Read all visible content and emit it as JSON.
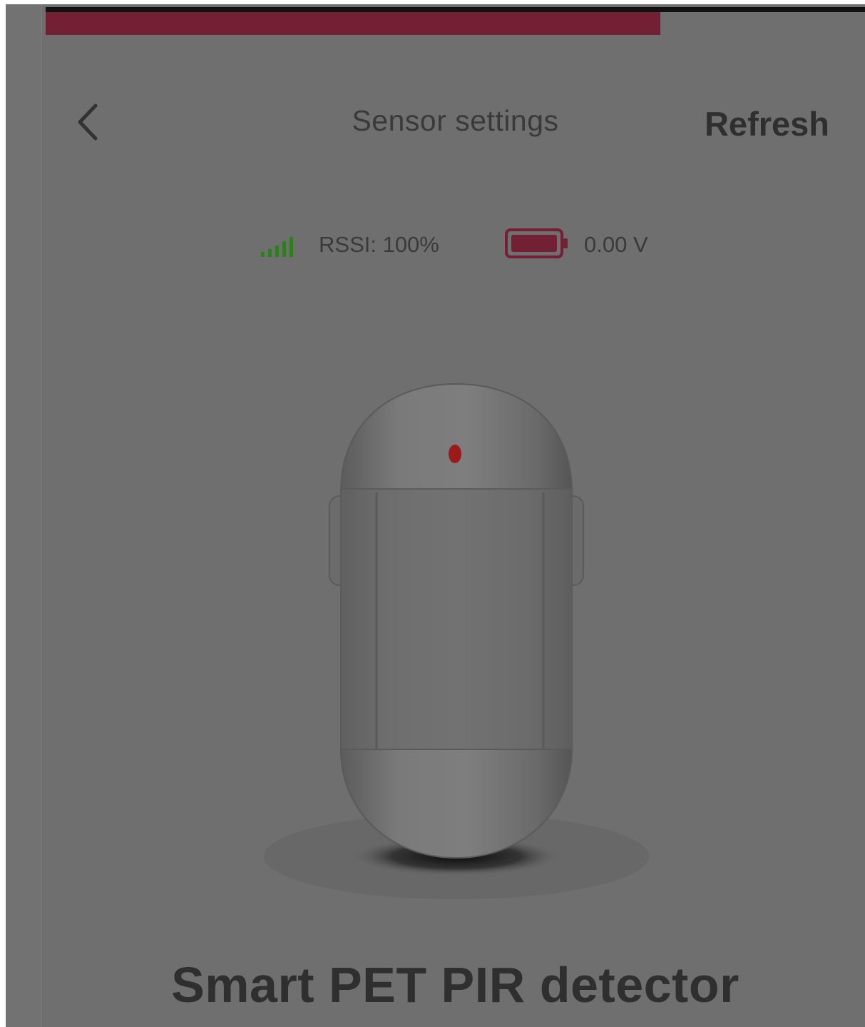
{
  "header": {
    "title": "Sensor settings",
    "refresh_label": "Refresh",
    "back_icon": "chevron-left-icon"
  },
  "progress": {
    "fraction": 0.75,
    "color": "#731f34"
  },
  "status": {
    "signal_icon": "signal-bars-icon",
    "rssi_text": "RSSI: 100%",
    "battery_icon": "battery-icon",
    "voltage_text": "0.00 V",
    "signal_color": "#2e7d1e",
    "battery_color": "#731f34"
  },
  "device": {
    "image_icon": "pir-detector-image",
    "name": "Smart PET PIR detector"
  }
}
